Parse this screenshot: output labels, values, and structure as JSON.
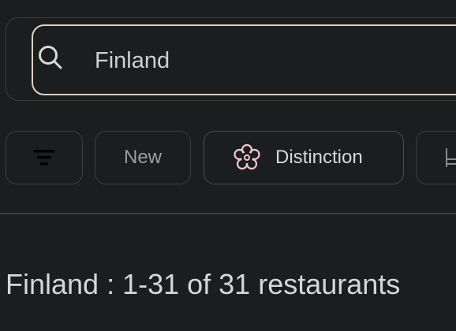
{
  "search": {
    "value": "Finland"
  },
  "filters": {
    "new_label": "New",
    "distinction_label": "Distinction"
  },
  "results": {
    "summary": "Finland : 1-31 of 31 restaurants"
  },
  "colors": {
    "background": "#1c1d1f",
    "search_border": "#ddd3c4",
    "distinction_icon": "#f2c6cf"
  },
  "icons": {
    "search": "search-icon",
    "filter": "filter-icon",
    "distinction": "michelin-star-icon",
    "seating": "seating-icon"
  }
}
